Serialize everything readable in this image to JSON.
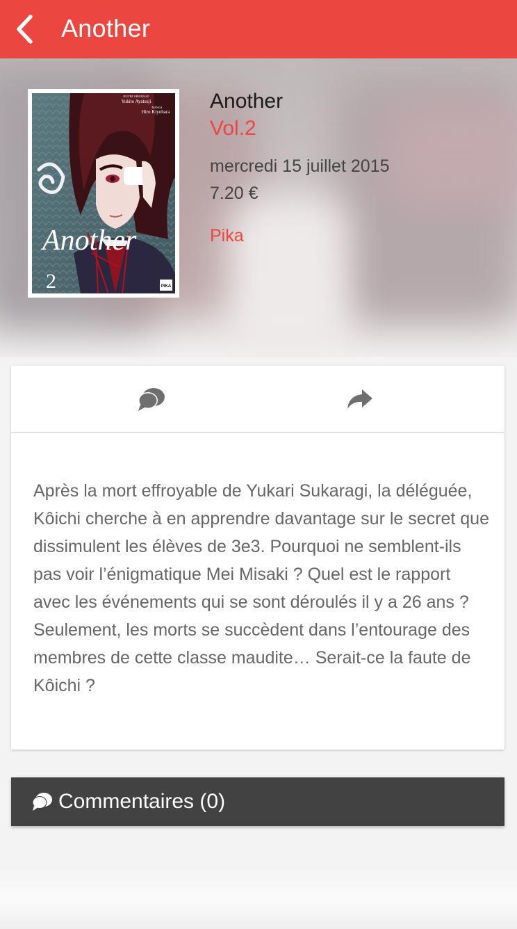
{
  "topbar": {
    "back_icon": "chevron-left-icon",
    "title": "Another"
  },
  "book": {
    "title": "Another",
    "volume": "Vol.2",
    "release_date": "mercredi 15 juillet 2015",
    "price": "7.20 €",
    "publisher": "Pika",
    "cover": {
      "credit_label_1": "ŒUVRE ORIGINALE",
      "author": "Yukito Ayatsuji",
      "credit_label_2": "MANGA",
      "artist": "Hiro Kiyohara",
      "logo_title": "Another",
      "volume_number": "2",
      "publisher_badge": "PIKA"
    }
  },
  "actions": {
    "comment_icon": "speech-bubble-icon",
    "share_icon": "share-arrow-icon"
  },
  "synopsis": "Après la mort effroyable de Yukari Sukaragi, la déléguée, Kôichi cherche à en apprendre davantage sur le secret que dissimulent les élèves de 3e3. Pourquoi ne semblent-ils pas voir l’énigmatique Mei Misaki ? Quel est le rapport avec les événements qui se sont déroulés il y a 26 ans ? Seulement, les morts se succèdent dans l’entourage des membres de cette classe maudite… Serait-ce la faute de Kôichi ?",
  "comments": {
    "icon": "speech-bubble-icon",
    "label": "Commentaires (0)"
  },
  "colors": {
    "accent": "#ec4641",
    "comments_bar": "#424242",
    "text_muted": "#666666"
  }
}
